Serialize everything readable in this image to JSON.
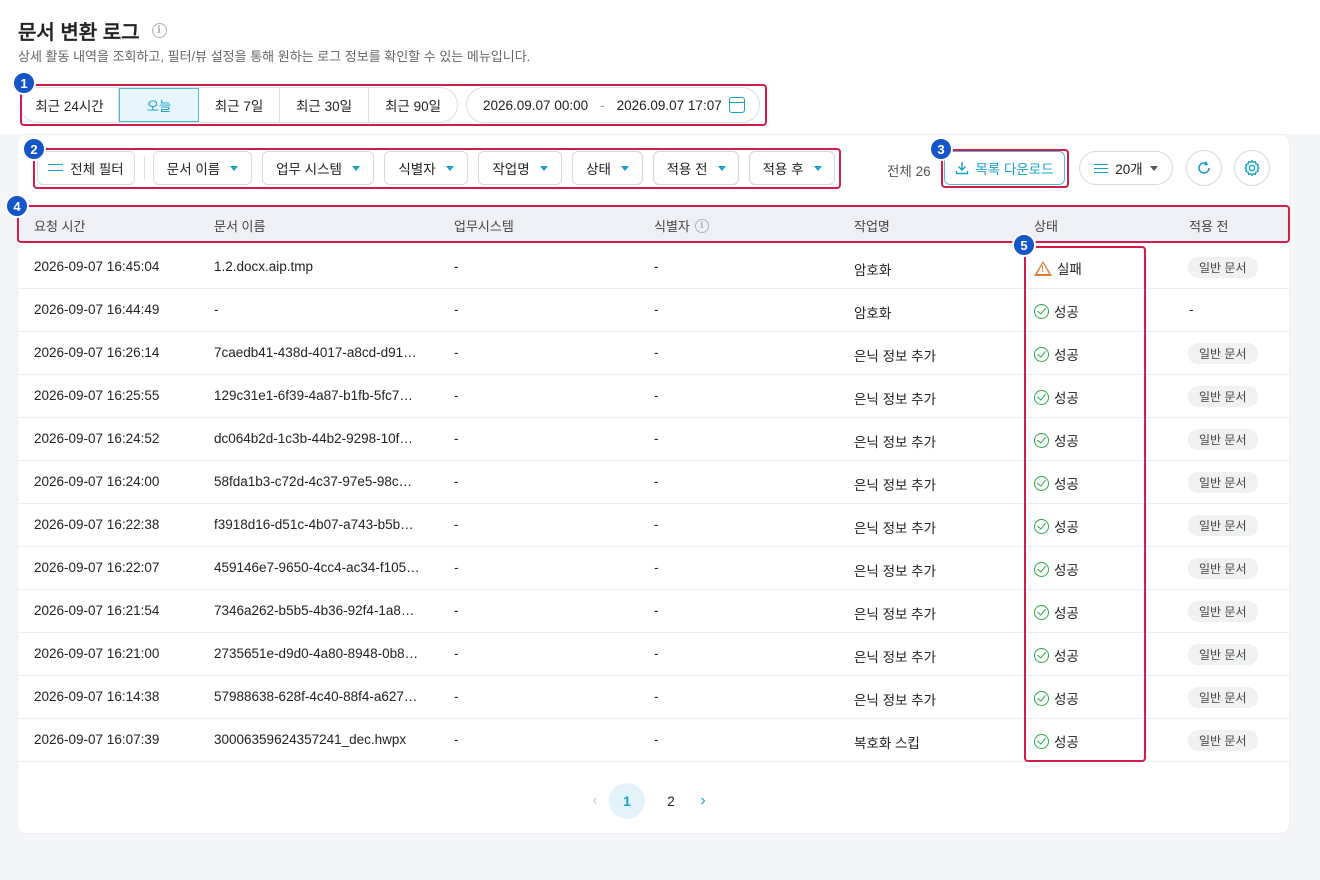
{
  "header": {
    "title": "문서 변환 로그",
    "subtitle": "상세 활동 내역을 조회하고, 필터/뷰 설정을 통해 원하는 로그 정보를 확인할 수 있는 메뉴입니다."
  },
  "callouts": [
    "1",
    "2",
    "3",
    "4",
    "5"
  ],
  "period": {
    "options": [
      "최근 24시간",
      "오늘",
      "최근 7일",
      "최근 30일",
      "최근 90일"
    ],
    "selected": "오늘",
    "start": "2026.09.07 00:00",
    "separator": "-",
    "end": "2026.09.07 17:07"
  },
  "filters": {
    "all_filter": "전체 필터",
    "items": [
      "문서 이름",
      "업무 시스템",
      "식별자",
      "작업명",
      "상태",
      "적용 전",
      "적용 후"
    ]
  },
  "toolbar": {
    "total": "전체 26",
    "download": "목록 다운로드",
    "page_size": "20개"
  },
  "table": {
    "columns": [
      "요청 시간",
      "문서 이름",
      "업무시스템",
      "식별자",
      "작업명",
      "상태",
      "적용 전"
    ],
    "rows": [
      {
        "time": "2026-09-07 16:45:04",
        "doc": "1.2.docx.aip.tmp",
        "system": "-",
        "id": "-",
        "job": "암호화",
        "status": "실패",
        "status_type": "fail",
        "before": "일반 문서"
      },
      {
        "time": "2026-09-07 16:44:49",
        "doc": "-",
        "system": "-",
        "id": "-",
        "job": "암호화",
        "status": "성공",
        "status_type": "ok",
        "before": "-"
      },
      {
        "time": "2026-09-07 16:26:14",
        "doc": "7caedb41-438d-4017-a8cd-d91…",
        "system": "-",
        "id": "-",
        "job": "은닉 정보 추가",
        "status": "성공",
        "status_type": "ok",
        "before": "일반 문서"
      },
      {
        "time": "2026-09-07 16:25:55",
        "doc": "129c31e1-6f39-4a87-b1fb-5fc7…",
        "system": "-",
        "id": "-",
        "job": "은닉 정보 추가",
        "status": "성공",
        "status_type": "ok",
        "before": "일반 문서"
      },
      {
        "time": "2026-09-07 16:24:52",
        "doc": "dc064b2d-1c3b-44b2-9298-10f…",
        "system": "-",
        "id": "-",
        "job": "은닉 정보 추가",
        "status": "성공",
        "status_type": "ok",
        "before": "일반 문서"
      },
      {
        "time": "2026-09-07 16:24:00",
        "doc": "58fda1b3-c72d-4c37-97e5-98c…",
        "system": "-",
        "id": "-",
        "job": "은닉 정보 추가",
        "status": "성공",
        "status_type": "ok",
        "before": "일반 문서"
      },
      {
        "time": "2026-09-07 16:22:38",
        "doc": "f3918d16-d51c-4b07-a743-b5b…",
        "system": "-",
        "id": "-",
        "job": "은닉 정보 추가",
        "status": "성공",
        "status_type": "ok",
        "before": "일반 문서"
      },
      {
        "time": "2026-09-07 16:22:07",
        "doc": "459146e7-9650-4cc4-ac34-f105…",
        "system": "-",
        "id": "-",
        "job": "은닉 정보 추가",
        "status": "성공",
        "status_type": "ok",
        "before": "일반 문서"
      },
      {
        "time": "2026-09-07 16:21:54",
        "doc": "7346a262-b5b5-4b36-92f4-1a8…",
        "system": "-",
        "id": "-",
        "job": "은닉 정보 추가",
        "status": "성공",
        "status_type": "ok",
        "before": "일반 문서"
      },
      {
        "time": "2026-09-07 16:21:00",
        "doc": "2735651e-d9d0-4a80-8948-0b8…",
        "system": "-",
        "id": "-",
        "job": "은닉 정보 추가",
        "status": "성공",
        "status_type": "ok",
        "before": "일반 문서"
      },
      {
        "time": "2026-09-07 16:14:38",
        "doc": "57988638-628f-4c40-88f4-a627…",
        "system": "-",
        "id": "-",
        "job": "은닉 정보 추가",
        "status": "성공",
        "status_type": "ok",
        "before": "일반 문서"
      },
      {
        "time": "2026-09-07 16:07:39",
        "doc": "30006359624357241_dec.hwpx",
        "system": "-",
        "id": "-",
        "job": "복호화 스킵",
        "status": "성공",
        "status_type": "ok",
        "before": "일반 문서"
      }
    ]
  },
  "pagination": {
    "pages": [
      "1",
      "2"
    ],
    "current": "1"
  },
  "colors": {
    "accent": "#15a0c8",
    "callout": "#d41c4b",
    "badge": "#1456c9",
    "success": "#2aa84a",
    "warning": "#e07a34"
  }
}
